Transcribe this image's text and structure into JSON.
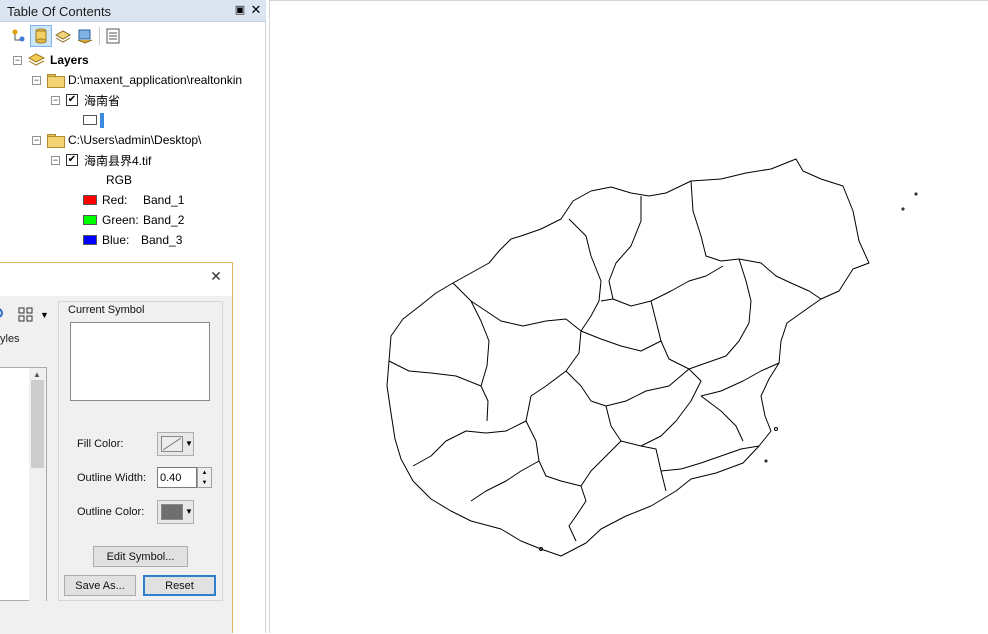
{
  "toc": {
    "title": "Table Of Contents",
    "pin_glyph": "⬍",
    "close_glyph": "✕",
    "toolbar": [
      {
        "name": "list-by-drawing-order-icon"
      },
      {
        "name": "list-by-source-icon"
      },
      {
        "name": "list-by-visibility-icon"
      },
      {
        "name": "list-by-selection-icon"
      },
      {
        "name": "options-icon"
      }
    ],
    "layers_label": "Layers",
    "groups": [
      {
        "path": "D:\\maxent_application\\realtonkin",
        "layers": [
          {
            "name": "海南省",
            "checked": true
          }
        ]
      },
      {
        "path": "C:\\Users\\admin\\Desktop\\",
        "layers": [
          {
            "name": "海南县界4.tif",
            "checked": true
          }
        ]
      }
    ],
    "rgb_label": "RGB",
    "bands": [
      {
        "channel": "Red:",
        "band": "Band_1",
        "color": "#ff0000"
      },
      {
        "channel": "Green:",
        "band": "Band_2",
        "color": "#00ff00"
      },
      {
        "channel": "Blue:",
        "band": "Band_3",
        "color": "#0000ff"
      }
    ]
  },
  "dialog": {
    "close_glyph": "✕",
    "styles_label": "yles",
    "current_symbol_label": "Current Symbol",
    "fill_color_label": "Fill Color:",
    "outline_width_label": "Outline Width:",
    "outline_width_value": "0.40",
    "outline_color_label": "Outline Color:",
    "outline_color": "#6e6e6e",
    "edit_symbol_label": "Edit Symbol...",
    "save_as_label": "Save As...",
    "reset_label": "Reset"
  },
  "colors": {
    "accent": "#2f7fd1",
    "title_bar": "#dbe5f1",
    "dialog_border": "#e0b458"
  }
}
